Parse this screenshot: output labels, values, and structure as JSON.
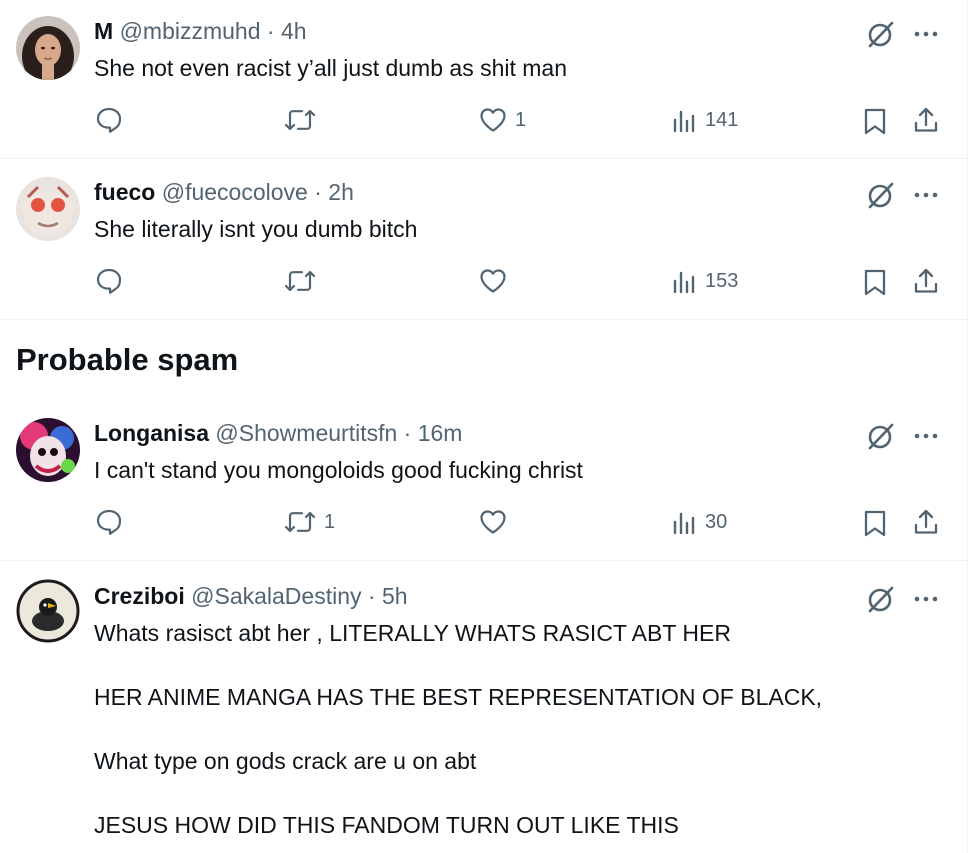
{
  "tweets": [
    {
      "name": "M",
      "handle": "@mbizzmuhd",
      "sep": "·",
      "time": "4h",
      "text": "She not even racist y’all just dumb as shit man",
      "replies": "",
      "retweets": "",
      "likes": "1",
      "views": "141"
    },
    {
      "name": "fueco",
      "handle": "@fuecocolove",
      "sep": "·",
      "time": "2h",
      "text": "She literally isnt you dumb bitch",
      "replies": "",
      "retweets": "",
      "likes": "",
      "views": "153"
    },
    {
      "name": "Longanisa",
      "handle": "@Showmeurtitsfn",
      "sep": "·",
      "time": "16m",
      "text": "I can't stand you mongoloids good fucking christ",
      "replies": "",
      "retweets": "1",
      "likes": "",
      "views": "30"
    },
    {
      "name": "Creziboi",
      "handle": "@SakalaDestiny",
      "sep": "·",
      "time": "5h",
      "text": "Whats rasisct abt her , LITERALLY WHATS RASICT ABT HER\n\nHER ANIME MANGA HAS THE BEST REPRESENTATION OF BLACK,\n\nWhat type on gods crack are u on abt\n\nJESUS HOW DID THIS FANDOM TURN OUT LIKE THIS"
    }
  ],
  "section": {
    "title": "Probable spam"
  },
  "icons": {
    "reply": "reply-icon",
    "retweet": "retweet-icon",
    "like": "heart-icon",
    "views": "views-icon",
    "bookmark": "bookmark-icon",
    "share": "share-icon",
    "grok": "grok-icon",
    "more": "more-icon"
  },
  "colors": {
    "text": "#0f1419",
    "secondary": "#536471",
    "border": "#eff3f4"
  }
}
